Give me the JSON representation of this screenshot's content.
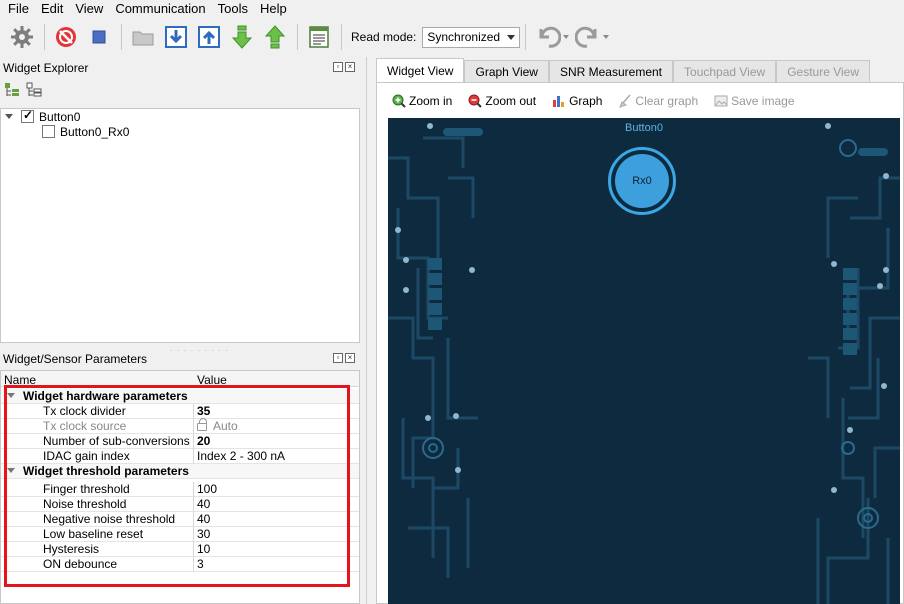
{
  "menu": [
    "File",
    "Edit",
    "View",
    "Communication",
    "Tools",
    "Help"
  ],
  "toolbar": {
    "read_mode_label": "Read mode:",
    "read_mode_value": "Synchronized"
  },
  "explorer": {
    "title": "Widget Explorer",
    "items": [
      {
        "label": "Button0",
        "checked": true
      },
      {
        "label": "Button0_Rx0",
        "checked": false
      }
    ]
  },
  "params": {
    "title": "Widget/Sensor Parameters",
    "col_name": "Name",
    "col_value": "Value",
    "groups": [
      {
        "label": "Widget hardware parameters",
        "rows": [
          {
            "name": "Tx clock divider",
            "value": "35"
          },
          {
            "name": "Tx clock source",
            "value": "Auto"
          },
          {
            "name": "Number of sub-conversions",
            "value": "20"
          },
          {
            "name": "IDAC gain index",
            "value": "Index 2 - 300 nA"
          }
        ]
      },
      {
        "label": "Widget threshold parameters",
        "rows": [
          {
            "name": "Finger threshold",
            "value": "100"
          },
          {
            "name": "Noise threshold",
            "value": "40"
          },
          {
            "name": "Negative noise threshold",
            "value": "40"
          },
          {
            "name": "Low baseline reset",
            "value": "30"
          },
          {
            "name": "Hysteresis",
            "value": "10"
          },
          {
            "name": "ON debounce",
            "value": "3"
          }
        ]
      }
    ]
  },
  "tabs": [
    "Widget View",
    "Graph View",
    "SNR Measurement",
    "Touchpad View",
    "Gesture View"
  ],
  "view_toolbar": {
    "zoom_in": "Zoom in",
    "zoom_out": "Zoom out",
    "graph": "Graph",
    "clear_graph": "Clear graph",
    "save_image": "Save image"
  },
  "canvas": {
    "widget_name": "Button0",
    "sensor_label": "Rx0"
  },
  "colors": {
    "highlight": "#e3141d",
    "canvas_bg": "#0e2a3f",
    "sensor": "#3d9fdc"
  }
}
